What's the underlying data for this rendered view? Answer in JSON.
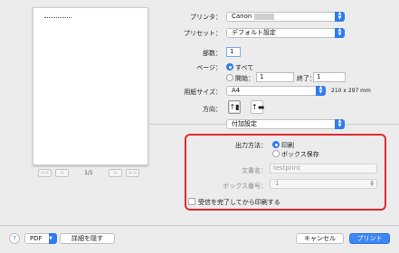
{
  "preview": {
    "page_indicator": "1/1",
    "first_btn": "<<",
    "prev_btn": "<",
    "next_btn": ">",
    "last_btn": ">>"
  },
  "printer": {
    "label": "プリンタ：",
    "value": "Canon"
  },
  "presets": {
    "label": "プリセット：",
    "value": "デフォルト設定"
  },
  "copies": {
    "label": "部数：",
    "value": "1"
  },
  "pages": {
    "label": "ページ：",
    "all_label": "すべて",
    "from_label": "開始：",
    "from_value": "1",
    "to_label": "終了：",
    "to_value": "1"
  },
  "paper_size": {
    "label": "用紙サイズ：",
    "value": "A4",
    "dimensions": "210 x 297 mm"
  },
  "orientation": {
    "label": "方向：",
    "portrait_glyph": "↑▮",
    "landscape_glyph": "↑▬"
  },
  "section_popup": {
    "value": "付加設定"
  },
  "output": {
    "label": "出力方法：",
    "print_label": "印刷",
    "mailbox_label": "ボックス保存",
    "doc_name_label": "文書名：",
    "doc_name_value": "testprint",
    "box_number_label": "ボックス番号：",
    "box_number_value": "1",
    "receive_checkbox_label": "受信を完了してから印刷する"
  },
  "bottom": {
    "help_glyph": "?",
    "pdf_label": "PDF",
    "hide_details_label": "詳細を隠す",
    "cancel_label": "キャンセル",
    "print_label": "プリント"
  },
  "colors": {
    "accent": "#2f7cf0",
    "highlight_border": "#e0262a"
  }
}
